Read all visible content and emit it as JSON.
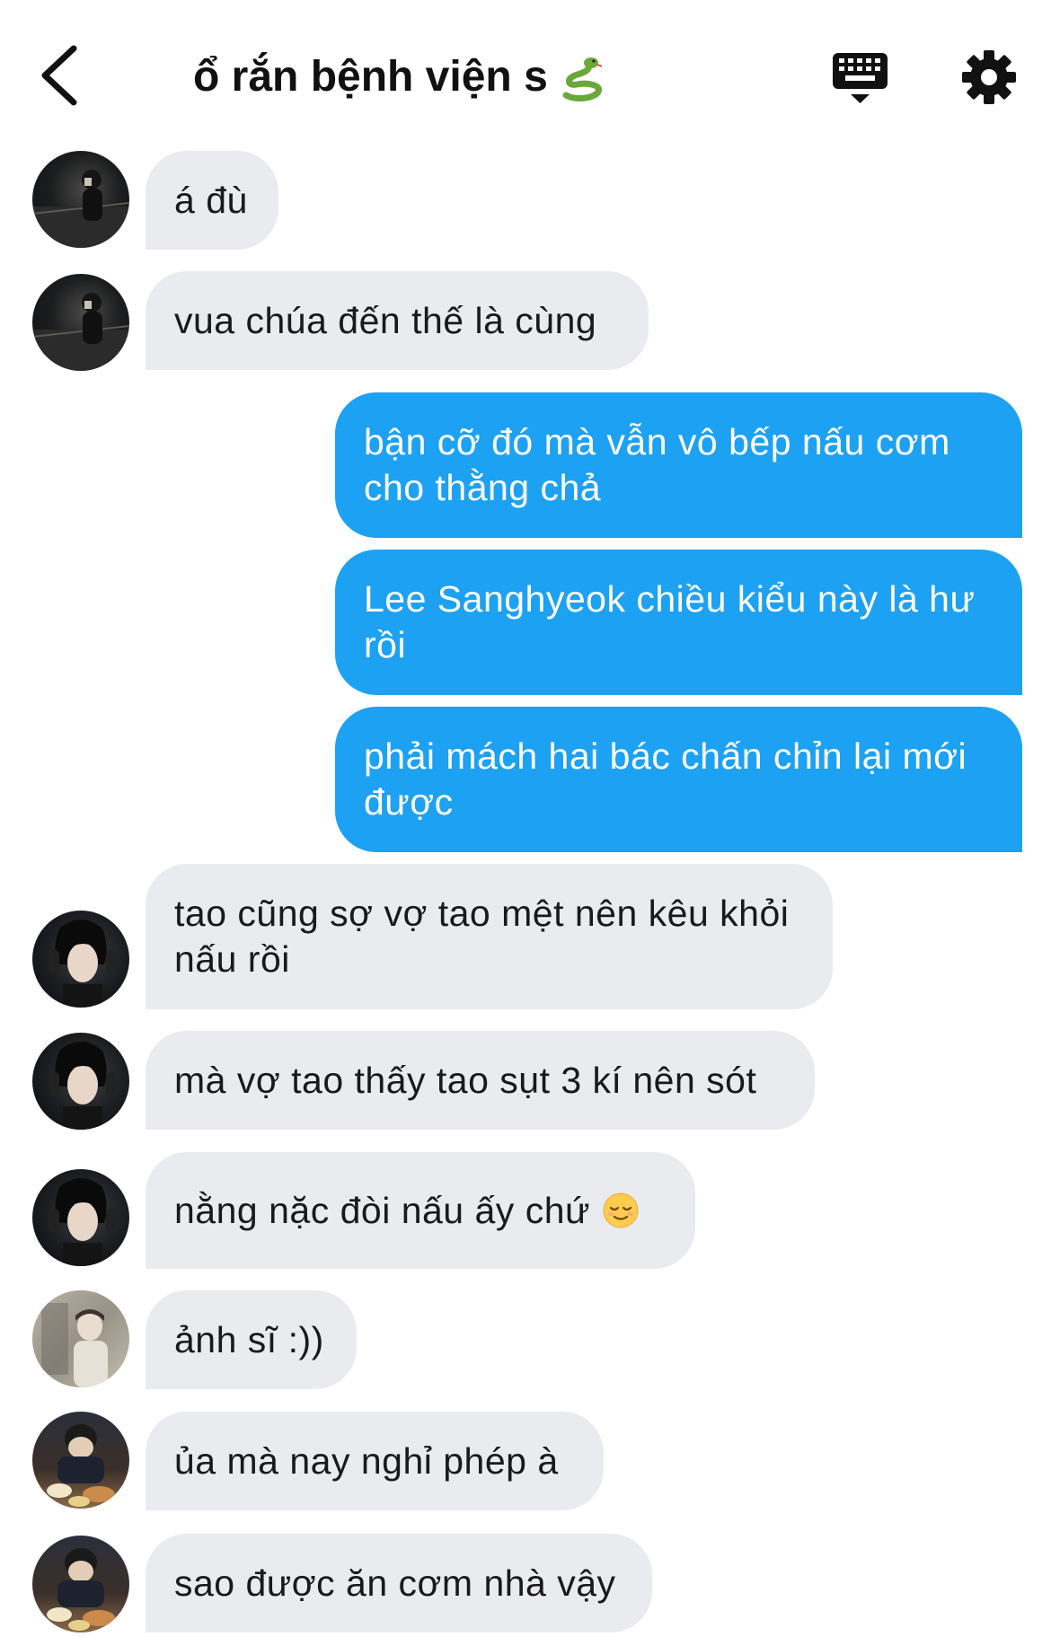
{
  "header": {
    "title": "ổ rắn bệnh viện s",
    "title_emoji": "snake-icon",
    "back_icon": "chevron-left-icon",
    "keyboard_icon": "keyboard-icon",
    "settings_icon": "gear-icon"
  },
  "colors": {
    "outgoing_bubble": "#1da1f2",
    "incoming_bubble": "#e9ebef"
  },
  "messages": [
    {
      "direction": "in",
      "text": "á đù"
    },
    {
      "direction": "in",
      "text": "vua chúa đến thế là cùng"
    },
    {
      "direction": "out",
      "text": "bận cỡ đó mà vẫn vô bếp nấu cơm cho thằng chả"
    },
    {
      "direction": "out",
      "text": "Lee Sanghyeok chiều kiểu này là hư rồi"
    },
    {
      "direction": "out",
      "text": "phải mách hai bác chấn chỉn lại mới được"
    },
    {
      "direction": "in",
      "text": "tao cũng sợ vợ tao mệt nên kêu khỏi nấu rồi"
    },
    {
      "direction": "in",
      "text": "mà vợ tao thấy tao sụt 3 kí nên sót"
    },
    {
      "direction": "in",
      "text": "nằng nặc đòi nấu ấy chứ",
      "emoji": "relieved-face-icon"
    },
    {
      "direction": "in",
      "text": "ảnh sĩ :))"
    },
    {
      "direction": "in",
      "text": "ủa mà nay nghỉ phép à"
    },
    {
      "direction": "in",
      "text": "sao được ăn cơm nhà vậy"
    }
  ]
}
